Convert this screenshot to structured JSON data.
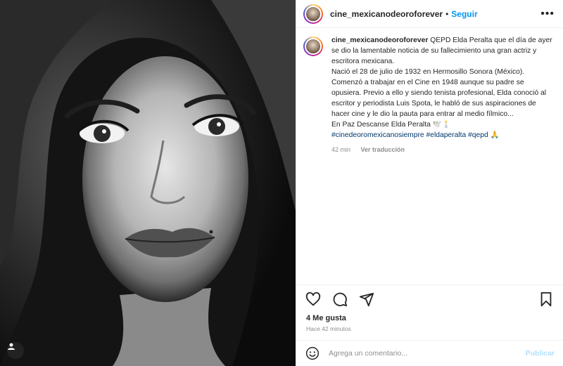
{
  "post": {
    "username": "cine_mexicanodeoroforever",
    "follow_label": "Seguir",
    "dot": "•",
    "more": "•••",
    "image_alt": "Retrato en blanco y negro de Elda Peralta"
  },
  "caption": {
    "username": "cine_mexicanodeoroforever",
    "line_intro": " QEPD Elda Peralta que el día de ayer se dio la lamentable noticia de su fallecimiento una gran actriz y escritora mexicana.",
    "line_born": "Nació el 28 de julio de 1932 en Hermosillo Sonora (México).",
    "line_career": "Comenzó a trabajar en el Cine en 1948 aunque su padre se opusiera. Previo a ello y siendo tenista profesional, Elda conoció al escritor y periodista Luis Spota, le habló de sus aspiraciones de hacer cine y le dio la pauta para entrar al medio fílmico...",
    "line_rip": "En Paz Descanse Elda Peralta 🕊️🕯️",
    "hashtags": "#cinedeoromexicanosiempre #eldaperalta #qepd",
    "hashtag_emoji": "🙏",
    "age": "42 min",
    "translate_label": "Ver traducción"
  },
  "engagement": {
    "likes": "4 Me gusta",
    "time_ago": "Hace 42 minutos"
  },
  "comment": {
    "placeholder": "Agrega un comentario...",
    "publish_label": "Publicar"
  },
  "icons": {
    "like": "heart-icon",
    "comment": "comment-icon",
    "share": "share-icon",
    "save": "bookmark-icon",
    "emoji": "emoji-icon",
    "user_tag": "user-tag-icon"
  },
  "colors": {
    "link_blue": "#0095f6",
    "hashtag": "#00376b",
    "muted": "#8e8e8e",
    "publish_disabled": "#b2dffc"
  }
}
